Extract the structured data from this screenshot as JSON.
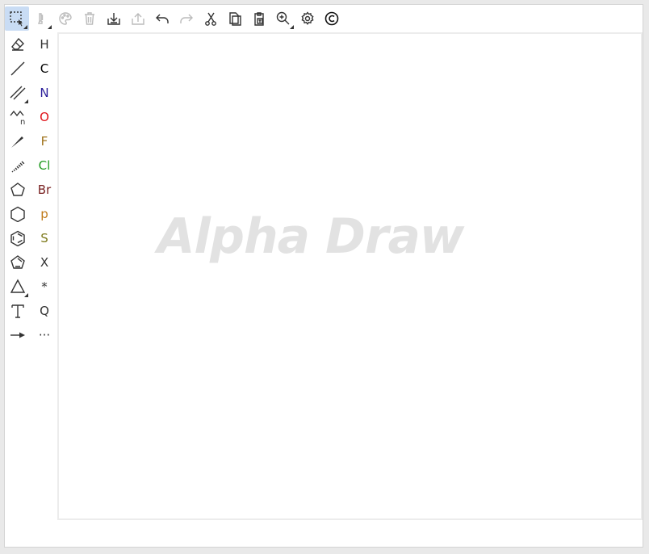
{
  "app": {
    "watermark": "Alpha Draw"
  },
  "top_toolbar": [
    {
      "name": "select-tool",
      "icon": "selection-rect-icon",
      "active": true
    },
    {
      "name": "erase-hand-tool",
      "icon": "hand-icon",
      "disabled": true
    },
    {
      "name": "palette-button",
      "icon": "palette-icon",
      "disabled": true
    },
    {
      "name": "delete-button",
      "icon": "trash-icon",
      "disabled": true
    },
    {
      "name": "import-button",
      "icon": "download-icon"
    },
    {
      "name": "export-button",
      "icon": "upload-icon",
      "disabled": true
    },
    {
      "name": "undo-button",
      "icon": "undo-icon"
    },
    {
      "name": "redo-button",
      "icon": "redo-icon",
      "disabled": true
    },
    {
      "name": "cut-button",
      "icon": "scissors-icon"
    },
    {
      "name": "copy-button",
      "icon": "copy-icon"
    },
    {
      "name": "paste-button",
      "icon": "paste-icon"
    },
    {
      "name": "zoom-button",
      "icon": "zoom-in-icon"
    },
    {
      "name": "settings-button",
      "icon": "gear-icon"
    },
    {
      "name": "about-button",
      "icon": "copyright-icon"
    }
  ],
  "left_tools": [
    "eraser-icon",
    "single-bond-icon",
    "double-bond-icon",
    "chain-icon",
    "wedge-bond-icon",
    "hash-bond-icon",
    "pentagon-icon",
    "hexagon-icon",
    "benzene-icon",
    "cyclopentadiene-icon",
    "triangle-icon",
    "text-icon",
    "arrow-icon"
  ],
  "atoms": [
    {
      "label": "H",
      "color": "#333333"
    },
    {
      "label": "C",
      "color": "#000000"
    },
    {
      "label": "N",
      "color": "#2b1f9a"
    },
    {
      "label": "O",
      "color": "#e0141b"
    },
    {
      "label": "F",
      "color": "#a0731c"
    },
    {
      "label": "Cl",
      "color": "#1f9a1f"
    },
    {
      "label": "Br",
      "color": "#7a2323"
    },
    {
      "label": "p",
      "color": "#c07a1a"
    },
    {
      "label": "S",
      "color": "#7d7a1c"
    },
    {
      "label": "X",
      "color": "#333333"
    },
    {
      "label": "*",
      "color": "#333333"
    },
    {
      "label": "Q",
      "color": "#333333"
    },
    {
      "label": "···",
      "color": "#333333"
    }
  ]
}
